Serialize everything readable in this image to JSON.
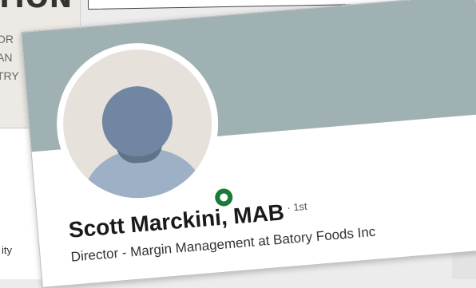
{
  "background": {
    "left_title": "TION",
    "left_lines": [
      "OR",
      "AN",
      "TRY"
    ],
    "left_bottom": "ity"
  },
  "profile": {
    "name": "Scott Marckini, MAB",
    "degree": "· 1st",
    "headline": "Director - Margin Management at Batory Foods Inc",
    "status": "online"
  },
  "colors": {
    "cover": "#a0b1b4",
    "status_online": "#1a7a3a",
    "avatar_head": "#7086a2",
    "avatar_body": "#9db0c5"
  }
}
